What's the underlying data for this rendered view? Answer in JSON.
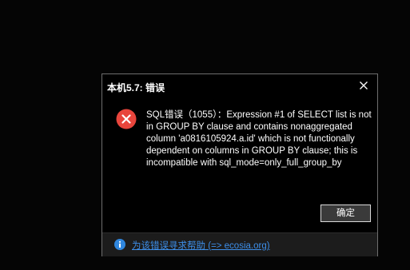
{
  "dialog": {
    "title": "本机5.7: 错误",
    "icon": "error-icon",
    "message": "SQL错误（1055）：Expression #1 of SELECT list is not in GROUP BY clause and contains nonaggregated column 'a0816105924.a.id' which is not functionally dependent on columns in GROUP BY clause; this is incompatible with sql_mode=only_full_group_by",
    "ok_label": "确定",
    "help_link": "为该错误寻求帮助 (=> ecosia.org)"
  },
  "colors": {
    "background": "#050505",
    "dialog_bg": "#000000",
    "error_red": "#e8453c",
    "link_blue": "#3d8ee8",
    "info_blue": "#2f86de"
  }
}
